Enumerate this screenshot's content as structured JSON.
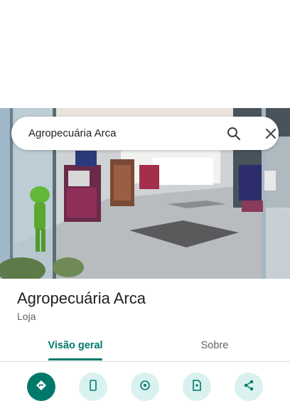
{
  "search": {
    "query": "Agropecuária Arca"
  },
  "place": {
    "name": "Agropecuária Arca",
    "category": "Loja"
  },
  "tabs": [
    {
      "label": "Visão geral",
      "selected": true
    },
    {
      "label": "Sobre",
      "selected": false
    }
  ],
  "actions": [
    {
      "icon": "directions-icon"
    },
    {
      "icon": "phone-icon"
    },
    {
      "icon": "location-icon"
    },
    {
      "icon": "save-icon"
    },
    {
      "icon": "share-icon"
    }
  ],
  "colors": {
    "accent": "#00796b",
    "accent_light": "#d9f2f0",
    "text_primary": "#202124",
    "text_secondary": "#5f6368"
  }
}
